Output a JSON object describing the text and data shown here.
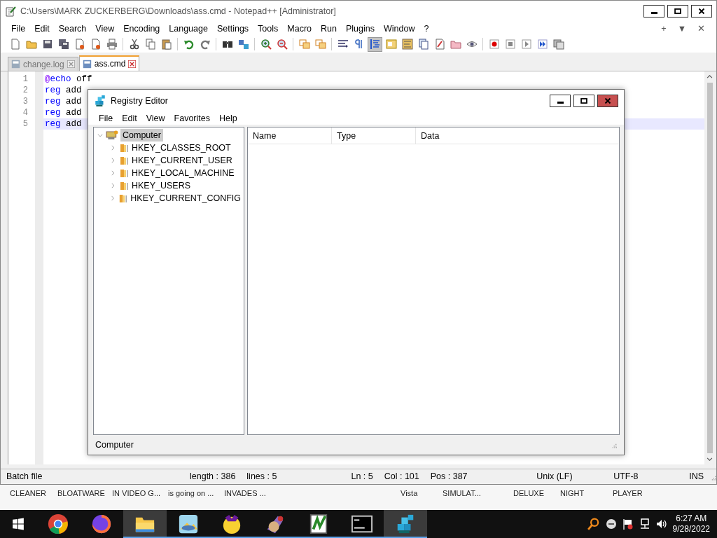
{
  "notepad": {
    "title": "C:\\Users\\MARK ZUCKERBERG\\Downloads\\ass.cmd - Notepad++ [Administrator]",
    "menu": [
      "File",
      "Edit",
      "Search",
      "View",
      "Encoding",
      "Language",
      "Settings",
      "Tools",
      "Macro",
      "Run",
      "Plugins",
      "Window",
      "?"
    ],
    "menu_right": [
      "+",
      "▼",
      "✕"
    ],
    "toolbar": [
      {
        "pressed": false
      },
      {
        "pressed": false
      },
      {
        "pressed": false
      },
      {
        "pressed": false
      },
      {
        "pressed": false
      },
      {
        "pressed": false
      },
      {
        "pressed": false
      },
      {
        "pressed": false
      },
      {
        "pressed": false
      },
      {
        "pressed": false
      },
      {
        "pressed": false
      },
      {
        "pressed": false
      },
      {
        "pressed": false
      },
      {
        "pressed": false
      },
      {
        "pressed": false
      },
      {
        "pressed": false
      },
      {
        "pressed": false
      },
      {
        "pressed": false
      },
      {
        "pressed": false
      },
      {
        "pressed": false
      },
      {
        "pressed": true
      },
      {
        "pressed": false
      },
      {
        "pressed": false
      },
      {
        "pressed": false
      },
      {
        "pressed": false
      },
      {
        "pressed": false
      },
      {
        "pressed": false
      },
      {
        "pressed": false
      },
      {
        "pressed": false
      },
      {
        "pressed": false
      },
      {
        "pressed": false
      },
      {
        "pressed": false
      }
    ],
    "tabs": [
      {
        "label": "change.log",
        "selected": false
      },
      {
        "label": "ass.cmd",
        "selected": true
      }
    ],
    "lines": [
      {
        "number": "1",
        "current": false,
        "tokens": [
          {
            "kind": "at",
            "text": "@"
          },
          {
            "kind": "keyword",
            "text": "echo"
          },
          {
            "kind": "plain",
            "text": " off"
          }
        ]
      },
      {
        "number": "2",
        "current": false,
        "tokens": [
          {
            "kind": "keyword",
            "text": "reg"
          },
          {
            "kind": "plain",
            "text": " add"
          }
        ]
      },
      {
        "number": "3",
        "current": false,
        "tokens": [
          {
            "kind": "keyword",
            "text": "reg"
          },
          {
            "kind": "plain",
            "text": " add"
          }
        ]
      },
      {
        "number": "4",
        "current": false,
        "tokens": [
          {
            "kind": "keyword",
            "text": "reg"
          },
          {
            "kind": "plain",
            "text": " add"
          }
        ]
      },
      {
        "number": "5",
        "current": true,
        "tokens": [
          {
            "kind": "keyword",
            "text": "reg"
          },
          {
            "kind": "plain",
            "text": " add"
          }
        ]
      }
    ],
    "status_bar": [
      "Batch file",
      "length : 386",
      "lines : 5",
      "Ln : 5",
      "Col : 101",
      "Pos : 387",
      "Unix (LF)",
      "UTF-8",
      "INS"
    ]
  },
  "regedit": {
    "title": "Registry Editor",
    "menu": [
      "File",
      "Edit",
      "View",
      "Favorites",
      "Help"
    ],
    "tree": {
      "label": "Computer",
      "expanded": true,
      "selected": true,
      "children": [
        {
          "label": "HKEY_CLASSES_ROOT",
          "expanded": false
        },
        {
          "label": "HKEY_CURRENT_USER",
          "expanded": false
        },
        {
          "label": "HKEY_LOCAL_MACHINE",
          "expanded": false
        },
        {
          "label": "HKEY_USERS",
          "expanded": false
        },
        {
          "label": "HKEY_CURRENT_CONFIG",
          "expanded": false
        }
      ]
    },
    "columns": [
      "Name",
      "Type",
      "Data"
    ],
    "status": "Computer"
  },
  "desktop_labels": [
    "CLEANER",
    "BLOATWARE",
    "IN VIDEO G...",
    "is going on ...",
    "INVADES ...",
    "Vista",
    "SIMULAT...",
    "DELUXE",
    "NIGHT",
    "PLAYER"
  ],
  "taskbar": {
    "apps": [
      {
        "open": false,
        "highlighted": false
      },
      {
        "open": false,
        "highlighted": false
      },
      {
        "open": true,
        "highlighted": true
      },
      {
        "open": true,
        "highlighted": false
      },
      {
        "open": true,
        "highlighted": false
      },
      {
        "open": true,
        "highlighted": false
      },
      {
        "open": true,
        "highlighted": false
      },
      {
        "open": true,
        "highlighted": false
      },
      {
        "open": true,
        "highlighted": true
      }
    ],
    "time": "6:27 AM",
    "date": "9/28/2022"
  }
}
